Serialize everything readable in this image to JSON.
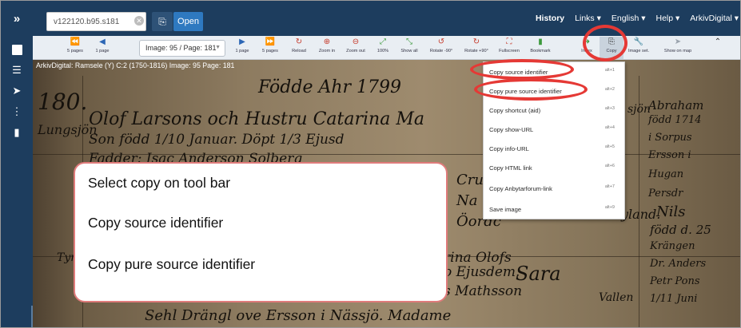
{
  "topbar": {
    "expand_icon": "double-chevron-right-icon",
    "identifier_value": "v122120.b95.s181",
    "open_label": "Open",
    "nav": [
      "History",
      "Links ▾",
      "English ▾",
      "Help ▾",
      "ArkivDigital ▾"
    ]
  },
  "toolbar": {
    "buttons": [
      {
        "icon": "⏪",
        "label": "5 pages"
      },
      {
        "icon": "◀",
        "label": "1 page"
      },
      {
        "icon": "▶",
        "label": "1 page"
      },
      {
        "icon": "⏩",
        "label": "5 pages"
      },
      {
        "icon": "↻",
        "label": "Reload"
      },
      {
        "icon": "⊕",
        "label": "Zoom in"
      },
      {
        "icon": "⊖",
        "label": "Zoom out"
      },
      {
        "icon": "⤢",
        "label": "100%"
      },
      {
        "icon": "⤡",
        "label": "Show all"
      },
      {
        "icon": "↺",
        "label": "Rotate -90°"
      },
      {
        "icon": "↻",
        "label": "Rotate +90°"
      },
      {
        "icon": "⛶",
        "label": "Fullscreen"
      },
      {
        "icon": "▮",
        "label": "Bookmark"
      },
      {
        "icon": "➜",
        "label": "Index"
      },
      {
        "icon": "⎘",
        "label": "Copy"
      },
      {
        "icon": "🔧",
        "label": "Image set."
      },
      {
        "icon": "➤",
        "label": "Show on map"
      },
      {
        "icon": "⌃",
        "label": ""
      }
    ],
    "image_select": "Image: 95 / Page: 181"
  },
  "caption": "ArkivDigital: Ramsele (Y) C:2 (1750-1816) Image: 95 Page: 181",
  "copy_menu": [
    {
      "label": "Copy source identifier",
      "shortcut": "alt+1"
    },
    {
      "label": "Copy pure source identifier",
      "shortcut": "alt+2"
    },
    {
      "label": "Copy shortcut (aid)",
      "shortcut": "alt+3"
    },
    {
      "label": "Copy show-URL",
      "shortcut": "alt+4"
    },
    {
      "label": "Copy info-URL",
      "shortcut": "alt+5"
    },
    {
      "label": "Copy HTML link",
      "shortcut": "alt+6"
    },
    {
      "label": "Copy Anbytarforum-link",
      "shortcut": "alt+7"
    },
    {
      "label": "Save image",
      "shortcut": "alt+9"
    }
  ],
  "annotation": {
    "line1": "Select copy on tool bar",
    "line2": "Copy source identifier",
    "line3": "Copy pure source identifier"
  },
  "colors": {
    "topbar": "#1d3d5e",
    "open_button": "#2e79c0",
    "highlight": "#e53935"
  }
}
